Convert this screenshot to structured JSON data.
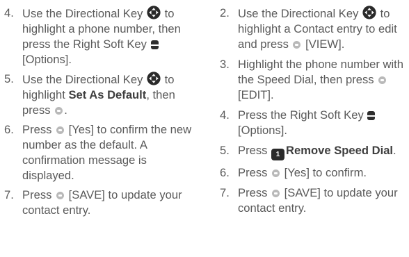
{
  "left_column": {
    "steps": [
      {
        "num": "4.",
        "parts": [
          "Use the Directional Key ",
          " to highlight a phone number, then press the Right Soft Key ",
          " [Options]."
        ]
      },
      {
        "num": "5.",
        "pre": "Use the Directional Key ",
        "mid": " to highlight ",
        "bold": "Set As Default",
        "post": ", then press ",
        "end": "."
      },
      {
        "num": "6.",
        "pre": "Press ",
        "post": " [Yes] to confirm the new number as the default. A confirmation message is displayed."
      },
      {
        "num": "7.",
        "pre": "Press ",
        "post": " [SAVE] to update your contact entry."
      }
    ]
  },
  "right_column": {
    "steps": [
      {
        "num": "2.",
        "pre": "Use the Directional Key ",
        "mid": " to highlight a Contact entry to edit and press ",
        "post": " [VIEW]."
      },
      {
        "num": "3.",
        "text": "Highlight the phone number with the Speed Dial, then press ",
        "post": " [EDIT]."
      },
      {
        "num": "4.",
        "pre": "Press the Right Soft Key ",
        "post": " [Options]."
      },
      {
        "num": "5.",
        "pre": "Press ",
        "key_label": "1",
        "bold": "Remove Speed Dial",
        "post": "."
      },
      {
        "num": "6.",
        "pre": "Press ",
        "post": " [Yes] to confirm."
      },
      {
        "num": "7.",
        "pre": "Press ",
        "post": " [SAVE] to update your contact entry."
      }
    ]
  },
  "icons": [
    "directional-key-icon",
    "ok-key-icon",
    "right-soft-key-icon",
    "voicemail-1-key-icon"
  ]
}
